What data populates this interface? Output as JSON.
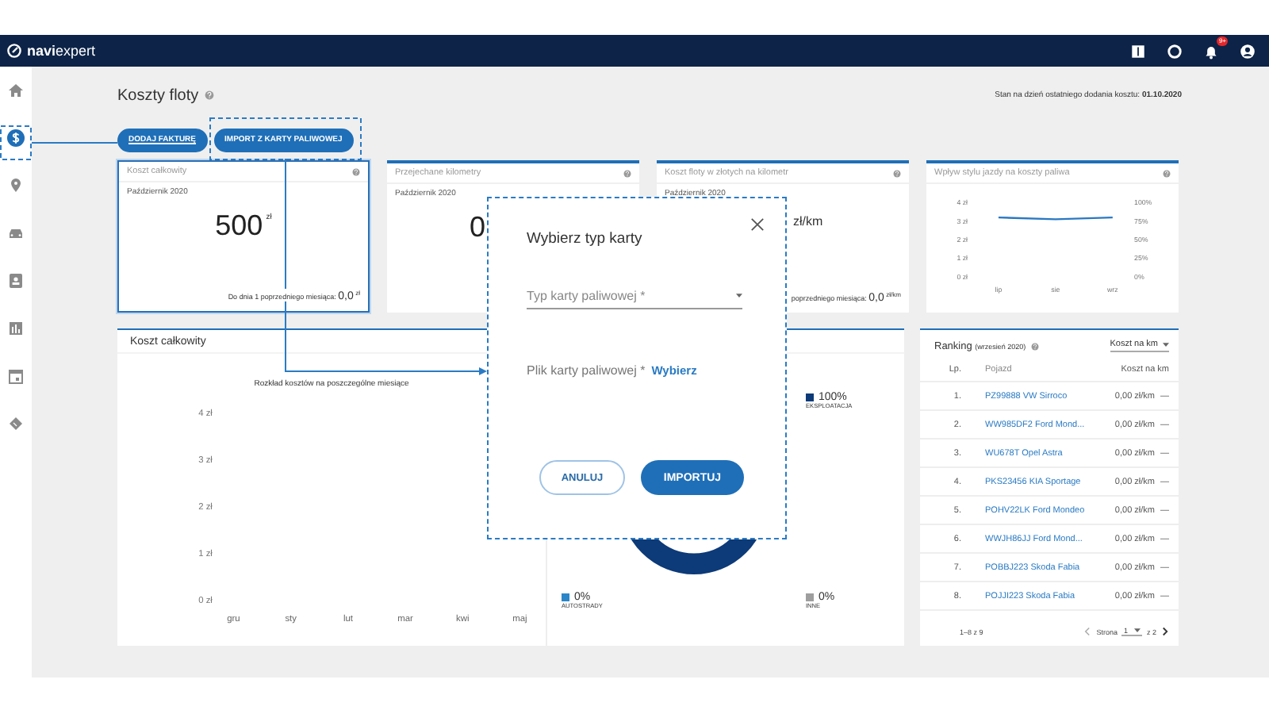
{
  "header": {
    "logo_bold": "navi",
    "logo_light": "expert",
    "notification_badge": "9+"
  },
  "sidebar": {
    "items": [
      {
        "kind": "home",
        "selected": false
      },
      {
        "kind": "money",
        "selected": true
      },
      {
        "kind": "pin",
        "selected": false
      },
      {
        "kind": "car",
        "selected": false
      },
      {
        "kind": "contact",
        "selected": false
      },
      {
        "kind": "chart",
        "selected": false
      },
      {
        "kind": "calendar",
        "selected": false
      },
      {
        "kind": "ticket",
        "selected": false
      }
    ]
  },
  "page": {
    "title": "Koszty floty",
    "last_update_label": "Stan na dzień ostatniego dodania kosztu:",
    "last_update_date": "01.10.2020"
  },
  "actions": [
    {
      "label": "DODAJ FAKTURĘ"
    },
    {
      "label": "IMPORT Z KARTY PALIWOWEJ"
    }
  ],
  "cards": [
    {
      "kind": "stat",
      "highlighted": true,
      "title": "Koszt całkowity",
      "period": "Październik 2020",
      "value": "500",
      "unit": "zł",
      "footer_label": "Do dnia 1 poprzedniego miesiąca:",
      "footer_value": "0,0",
      "footer_unit": "zł"
    },
    {
      "kind": "stat",
      "highlighted": false,
      "title": "Przejechane kilometry",
      "period": "Październik 2020",
      "value": "0"
    },
    {
      "kind": "stat",
      "highlighted": false,
      "title": "Koszt floty w złotych na kilometr",
      "period": "Październik 2020",
      "unit": "zł/km",
      "footer_label": "poprzedniego miesiąca:",
      "footer_value": "0,0",
      "footer_unit": "zł/km"
    },
    {
      "kind": "chart",
      "highlighted": false,
      "title": "Wpływ stylu jazdy na koszty paliwa",
      "right_axis_labels": [
        "100%",
        "75%",
        "50%",
        "25%",
        "0%"
      ],
      "chart_data": {
        "type": "line",
        "categories": [
          "lip",
          "sie",
          "wrz"
        ],
        "series": [
          {
            "color": "#2a78c2",
            "values": [
              3.2,
              3.1,
              3.2
            ]
          }
        ],
        "ylim": [
          0,
          4
        ],
        "yticks": [
          {
            "value": 4,
            "label": "4 zł"
          },
          {
            "value": 3,
            "label": "3 zł"
          },
          {
            "value": 2,
            "label": "2 zł"
          },
          {
            "value": 1,
            "label": "1 zł"
          },
          {
            "value": 0,
            "label": "0 zł"
          }
        ]
      }
    }
  ],
  "cost_panel": {
    "title": "Koszt całkowity",
    "chart_data": {
      "type": "bar",
      "title": "Rozkład kosztów na poszczególne miesiące",
      "categories": [
        "gru",
        "sty",
        "lut",
        "mar",
        "kwi",
        "maj"
      ],
      "values": [
        0,
        0,
        0,
        0,
        0,
        0
      ],
      "ylim": [
        0,
        4
      ],
      "yticks": [
        {
          "value": 4,
          "label": "4 zł"
        },
        {
          "value": 3,
          "label": "3 zł"
        },
        {
          "value": 2,
          "label": "2 zł"
        },
        {
          "value": 1,
          "label": "1 zł"
        },
        {
          "value": 0,
          "label": "0 zł"
        }
      ]
    },
    "legend": [
      {
        "value": "100%",
        "label": "EKSPLOATACJA",
        "color": "#0d3a78"
      },
      {
        "value": "0%",
        "label": "AUTOSTRADY",
        "color": "#2a86c8"
      },
      {
        "value": "0%",
        "label": "INNE",
        "color": "#9e9e9e"
      }
    ]
  },
  "ranking": {
    "title": "Ranking",
    "period": "(wrzesień 2020)",
    "sort": "Koszt na km",
    "columns": [
      "Lp.",
      "Pojazd",
      "Koszt na km"
    ],
    "rows": [
      {
        "rank": "1.",
        "vehicle": "PZ99888 VW Sirroco",
        "cost": "0,00 zł/km",
        "trend": "—"
      },
      {
        "rank": "2.",
        "vehicle": "WW985DF2 Ford Mond...",
        "cost": "0,00 zł/km",
        "trend": "—"
      },
      {
        "rank": "3.",
        "vehicle": "WU678T Opel Astra",
        "cost": "0,00 zł/km",
        "trend": "—"
      },
      {
        "rank": "4.",
        "vehicle": "PKS23456 KIA Sportage",
        "cost": "0,00 zł/km",
        "trend": "—"
      },
      {
        "rank": "5.",
        "vehicle": "POHV22LK Ford Mondeo",
        "cost": "0,00 zł/km",
        "trend": "—"
      },
      {
        "rank": "6.",
        "vehicle": "WWJH86JJ Ford Mond...",
        "cost": "0,00 zł/km",
        "trend": "—"
      },
      {
        "rank": "7.",
        "vehicle": "POBBJ223 Skoda Fabia",
        "cost": "0,00 zł/km",
        "trend": "—"
      },
      {
        "rank": "8.",
        "vehicle": "POJJI223 Skoda Fabia",
        "cost": "0,00 zł/km",
        "trend": "—"
      }
    ],
    "range": "1–8 z 9",
    "page_label": "Strona",
    "page": "1",
    "page_total": "z 2"
  },
  "modal": {
    "title": "Wybierz typ karty",
    "select_placeholder": "Typ karty paliwowej *",
    "file_label": "Plik karty paliwowej *",
    "file_link": "Wybierz",
    "cancel": "ANULUJ",
    "confirm": "IMPORTUJ"
  }
}
